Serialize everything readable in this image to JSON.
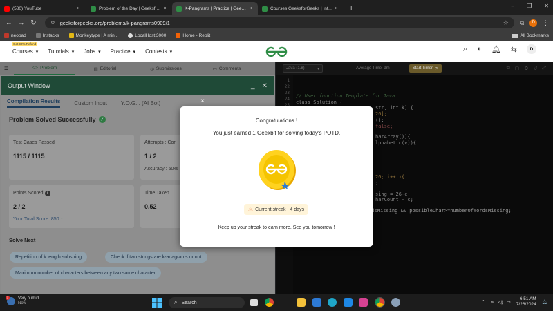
{
  "browser": {
    "tabs": [
      {
        "title": "(580) YouTube",
        "color": "#ff0000"
      },
      {
        "title": "Problem of the Day | GeeksforG...",
        "color": "#2f8d46"
      },
      {
        "title": "K-Pangrams | Practice | GeeksforG...",
        "color": "#2f8d46"
      },
      {
        "title": "Courses GeeksforGeeks | Interac...",
        "color": "#2f8d46"
      }
    ],
    "new_tab": "+",
    "url": "geeksforgeeks.org/problems/k-pangrams0909/1",
    "profile_letter": "D",
    "bookmarks": [
      {
        "label": "neopad",
        "color": "#c0392b"
      },
      {
        "label": "Instacks",
        "color": "#555555"
      },
      {
        "label": "Monkeytype | A min...",
        "color": "#e2b714"
      },
      {
        "label": "LocalHost:3000",
        "color": "#dddddd"
      },
      {
        "label": "Home - Replit",
        "color": "#f26207"
      }
    ],
    "all_bookmarks": "All Bookmarks"
  },
  "gfg_nav": {
    "refund_badge": "Get 90% Refund",
    "items": [
      "Courses",
      "Tutorials",
      "Jobs",
      "Practice",
      "Contests"
    ],
    "avatar_letter": "D"
  },
  "left_tabs": [
    "Problem",
    "Editorial",
    "Submissions",
    "Comments"
  ],
  "output_window": {
    "title": "Output Window",
    "tabs": [
      "Compilation Results",
      "Custom Input",
      "Y.O.G.I. (AI Bot)"
    ],
    "solved_title": "Problem Solved Successfully",
    "cards": {
      "test_cases_label": "Test Cases Passed",
      "test_cases_value": "1115 / 1115",
      "attempts_label": "Attempts : Cor",
      "attempts_value": "1 / 2",
      "accuracy_label": "Accuracy : 50%",
      "points_label": "Points Scored",
      "points_value": "2 / 2",
      "total_score": "Your Total Score: 850",
      "time_label": "Time Taken",
      "time_value": "0.52"
    },
    "solve_next_title": "Solve Next",
    "solve_next": [
      "Repetition of k length substring",
      "Check if two strings are k-anagrams or not",
      "Maximum number of characters between any two same character"
    ]
  },
  "editor": {
    "language": "Java (1.8)",
    "avg_time": "Average Time: 9m",
    "start_timer": "Start Timer",
    "line_numbers": [
      "1",
      "22",
      "23",
      "24",
      "25"
    ],
    "code_lines": [
      "// User function Template for Java",
      "class Solution {",
      "str, int k) {",
      "26];",
      "();",
      "false;",
      "harArray()){",
      "lphabetic(v)){",
      "26; i++ ){",
      ";",
      "sing = 26-c;",
      "harCount - c;",
      "ordsMissing && possibleChar>=numberOfWordsMissing;"
    ]
  },
  "modal": {
    "title": "Congratulations !",
    "message": "You just earned 1 Geekbit for solving today's POTD.",
    "streak": "Current streak : 4 days",
    "footer": "Keep up your streak to earn more. See you tomorrow !",
    "close": "×"
  },
  "taskbar": {
    "weather_title": "Very humid",
    "weather_sub": "Now",
    "weather_badge": "1",
    "search": "Search",
    "time": "6:51 AM",
    "date": "7/26/2024",
    "accent": "#0a64c8"
  }
}
